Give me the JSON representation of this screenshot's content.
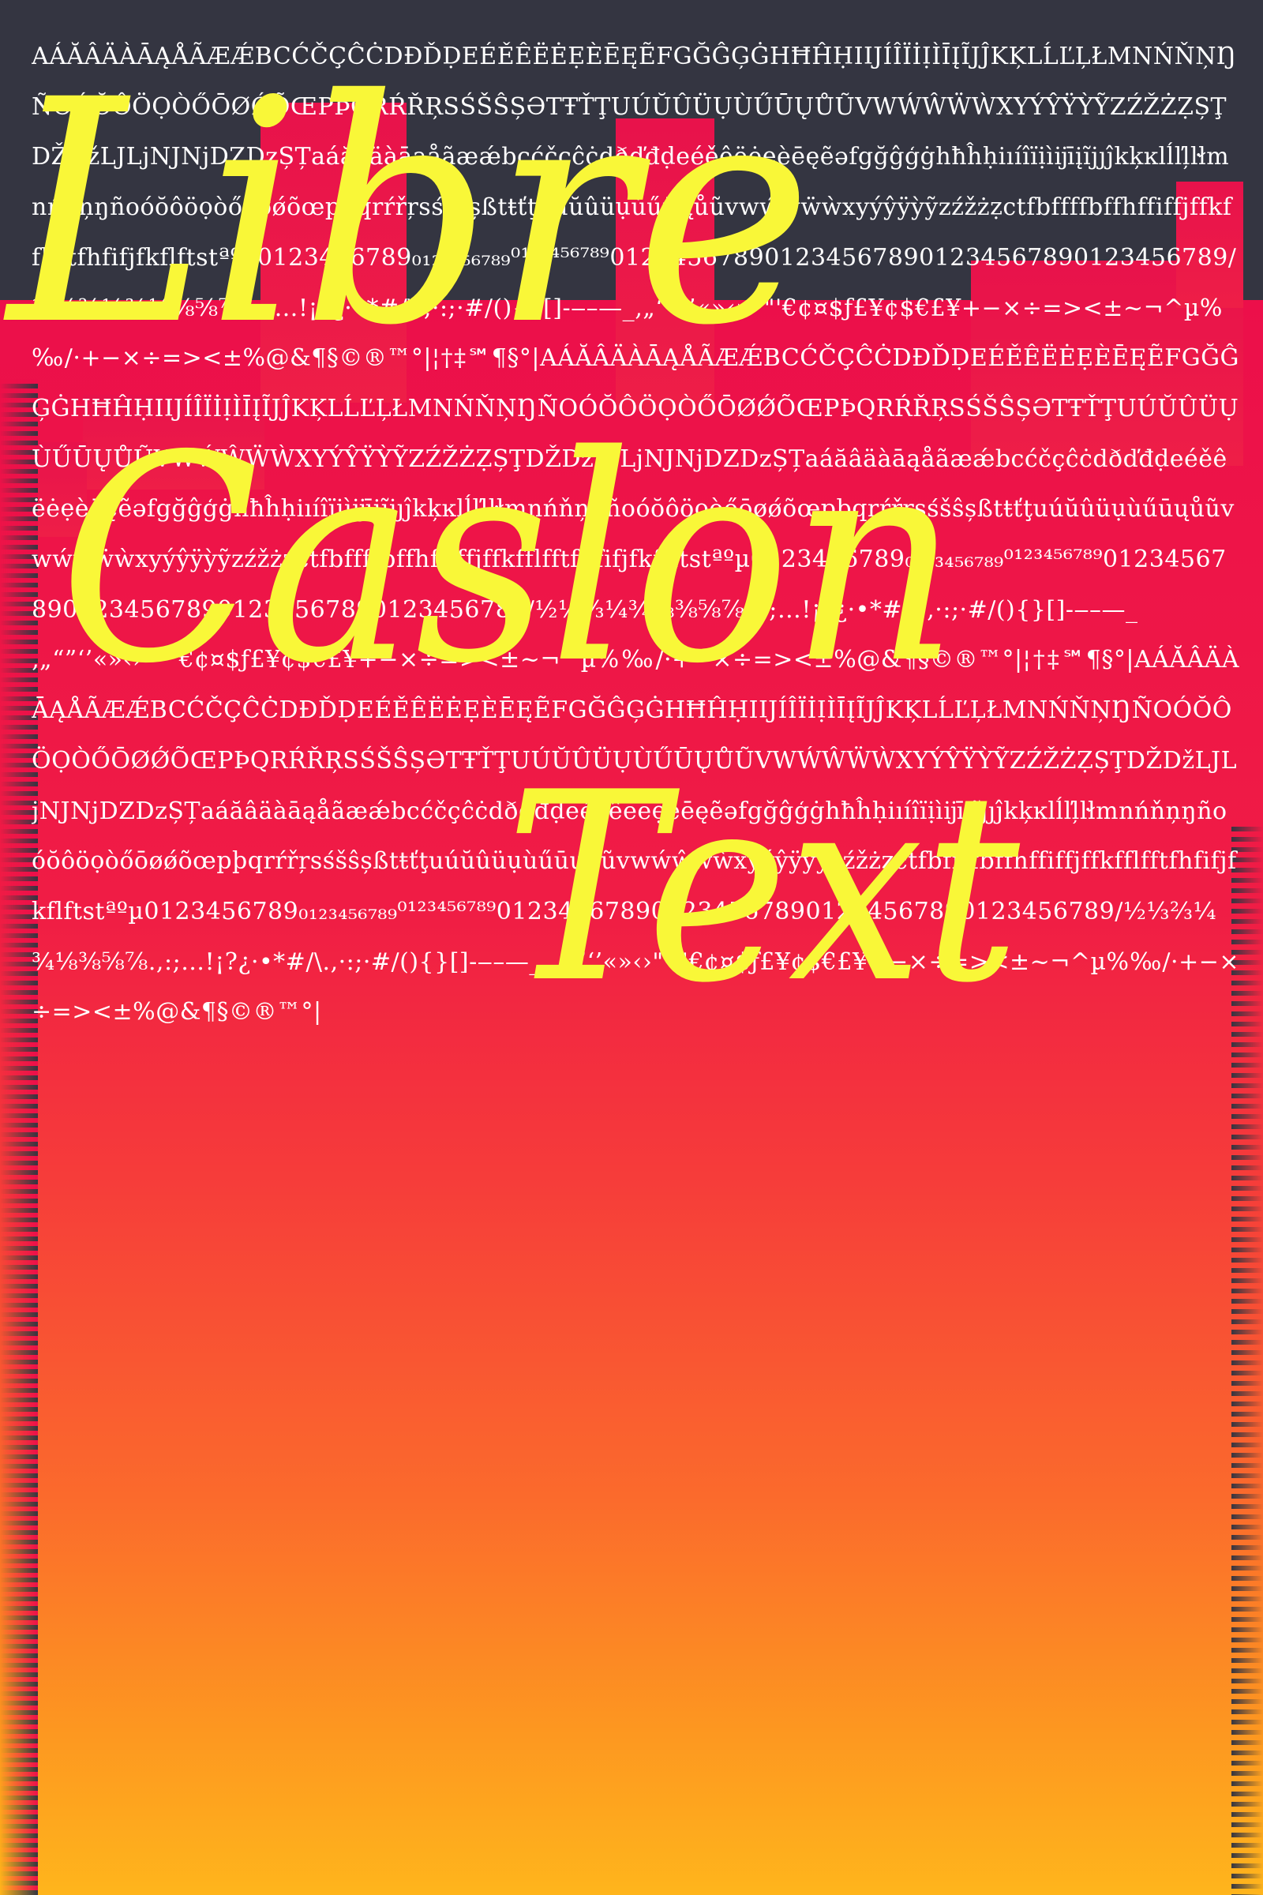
{
  "poster": {
    "title_lines": [
      "Libre",
      "Caslon",
      "Text"
    ],
    "glyph_sample": "AÁĂÂÄÀĀĄÅÃÆǼBCĆČÇĈĊDĐĎḌEÉĚÊËĖẸÈĒĘẼFGĞĜĢĠHĦĤḤIĲÍÎÏİỊÌĪĮĨJĴKĶLĹĽĻŁMNŃŇŅŊÑOÓŎÔÖỌÒŐŌØǾÕŒPÞQRŔŘŖSŚŠŜȘƏTŦŤŢUÚŬÛÜỤÙŰŪŲŮŨVWẂŴẄẀXYÝŶŸỲỸZŹŽŻẒȘŢDŽDžLJLjNJNjDZDzȘȚaáăâäàāąåãæǽbcćčçĉċdðďđḍeéěêëėẹèēęẽəfgğĝģġhħĥḥiıíîïịìĳīįĩjȷĵkķĸlĺľļŀłmnńňņŋñoóŏôöọòőōøǿõœpþqrŕřŗsśšŝșßtŧťţuúŭûüụùűūųůũvwẃŵẅẁxyýŷÿỳỹzźžżẓctfbffffbffhffiffjffkfflfftfhfifjfkflftstªºµ0123456789₀₁₂₃₄₅₆₇₈₉⁰¹²³⁴⁵⁶⁷⁸⁹0123456789012345678901234567890123456789/½⅓⅔¼¾⅛⅜⅝⅞.,:;…!¡?¿·•*#/\\.,·:;·#/(){}[]-‒–—_‚„“”‘’«»‹›\"'\"'€¢¤$ƒ£¥¢$€£¥+−×÷=><±~¬^µ%‰/·+−×÷=><±%@&¶§©®™°|¦†‡℠¶§°|AÁĂÂÄÀĀĄÅÃÆǼBCĆČÇĈĊDĐĎḌEÉĚÊËĖẸÈĒĘẼFGĞĜĢĠHĦĤḤIĲÍÎÏİỊÌĪĮĨJĴKĶLĹĽĻŁMNŃŇŅŊÑOÓŎÔÖỌÒŐŌØǾÕŒPÞQRŔŘŖSŚŠŜȘƏTŦŤŢUÚŬÛÜỤÙŰŪŲŮŨVWẂŴẄẀXYÝŶŸỲỸZŹŽŻẒȘŢDŽDžLJLjNJNjDZDzȘȚaáăâäàāąåãæǽbcćčçĉċdðďđḍeéěêëėẹèēęẽəfgğĝģġhħĥḥiıíîïịìĳīįĩjȷĵkķĸlĺľļŀłmnńňņŋñoóŏôöọòőōøǿõœpþqrŕřŗsśšŝșßtŧťţuúŭûüụùűūųůũvwẃŵẅẁxyýŷÿỳỹzźžżẓctfbffffbffhffiffjffkfflfftfhfifjfkflftstªºµ0123456789₀₁₂₃₄₅₆₇₈₉⁰¹²³⁴⁵⁶⁷⁸⁹0123456789012345678901234567890123456789/½⅓⅔¼¾⅛⅜⅝⅞.,:;…!¡?¿·•*#/\\.,·:;·#/(){}[]-‒–—_‚„“”‘’«»‹›\"'\"'€¢¤$ƒ£¥¢$€£¥+−×÷=><±~¬^µ%‰/·+−×÷=><±%@&¶§©®™°|¦†‡℠¶§°|AÁĂÂÄÀĀĄÅÃÆǼBCĆČÇĈĊDĐĎḌEÉĚÊËĖẸÈĒĘẼFGĞĜĢĠHĦĤḤIĲÍÎÏİỊÌĪĮĨJĴKĶLĹĽĻŁMNŃŇŅŊÑOÓŎÔÖỌÒŐŌØǾÕŒPÞQRŔŘŖSŚŠŜȘƏTŦŤŢUÚŬÛÜỤÙŰŪŲŮŨVWẂŴẄẀXYÝŶŸỲỸZŹŽŻẒȘŢDŽDžLJLjNJNjDZDzȘȚaáăâäàāąåãæǽbcćčçĉċdðďđḍeéěêëėẹèēęẽəfgğĝģġhħĥḥiıíîïịìĳīįĩjȷĵkķĸlĺľļŀłmnńňņŋñoóŏôöọòőōøǿõœpþqrŕřŗsśšŝșßtŧťţuúŭûüụùűūųůũvwẃŵẅẁxyýŷÿỳỹzźžżẓctfbffffbffhffiffjffkfflfftfhfifjfkflftstªºµ0123456789₀₁₂₃₄₅₆₇₈₉⁰¹²³⁴⁵⁶⁷⁸⁹0123456789012345678901234567890123456789/½⅓⅔¼¾⅛⅜⅝⅞.,:;…!¡?¿·•*#/\\.,·:;·#/(){}[]-‒–—_‚„“”‘’«»‹›\"'\"'€¢¤$ƒ£¥¢$€£¥+−×÷=><±~¬^µ%‰/·+−×÷=><±%@&¶§©®™°|"
  },
  "colors": {
    "background_dark": "#343541",
    "gradient_top": "#ec0f4a",
    "gradient_bottom": "#ffb51c",
    "title": "#f9f738",
    "glyphs": "#ffffff"
  }
}
